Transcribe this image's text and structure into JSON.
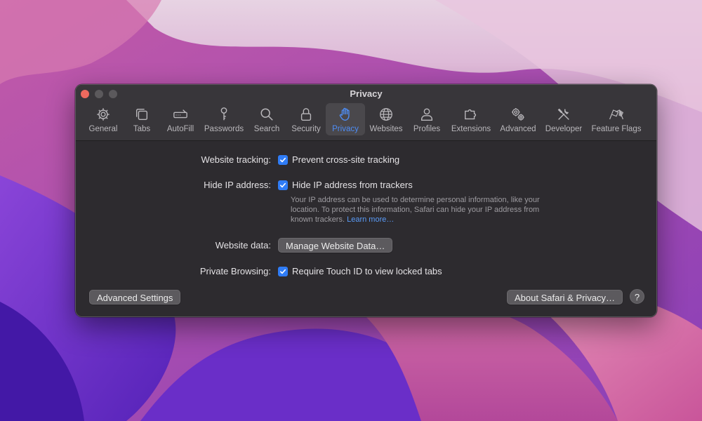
{
  "window": {
    "title": "Privacy"
  },
  "toolbar": {
    "items": [
      {
        "label": "General",
        "icon": "gear-icon"
      },
      {
        "label": "Tabs",
        "icon": "tabs-icon"
      },
      {
        "label": "AutoFill",
        "icon": "autofill-icon"
      },
      {
        "label": "Passwords",
        "icon": "key-icon"
      },
      {
        "label": "Search",
        "icon": "search-icon"
      },
      {
        "label": "Security",
        "icon": "lock-icon"
      },
      {
        "label": "Privacy",
        "icon": "hand-icon",
        "selected": true
      },
      {
        "label": "Websites",
        "icon": "globe-icon"
      },
      {
        "label": "Profiles",
        "icon": "person-icon"
      },
      {
        "label": "Extensions",
        "icon": "puzzle-icon"
      },
      {
        "label": "Advanced",
        "icon": "gears-icon"
      },
      {
        "label": "Developer",
        "icon": "tools-icon"
      },
      {
        "label": "Feature Flags",
        "icon": "flags-icon"
      }
    ],
    "accent_color": "#4e8df5"
  },
  "privacy": {
    "tracking_label": "Website tracking:",
    "tracking_checkbox": "Prevent cross-site tracking",
    "tracking_checked": true,
    "hide_ip_label": "Hide IP address:",
    "hide_ip_checkbox": "Hide IP address from trackers",
    "hide_ip_checked": true,
    "hide_ip_desc": "Your IP address can be used to determine personal information, like your location. To protect this information, Safari can hide your IP address from known trackers.",
    "learn_more": "Learn more…",
    "website_data_label": "Website data:",
    "manage_button": "Manage Website Data…",
    "private_label": "Private Browsing:",
    "private_checkbox": "Require Touch ID to view locked tabs",
    "private_checked": true
  },
  "footer": {
    "advanced_button": "Advanced Settings",
    "about_button": "About Safari & Privacy…",
    "help_button": "?"
  }
}
